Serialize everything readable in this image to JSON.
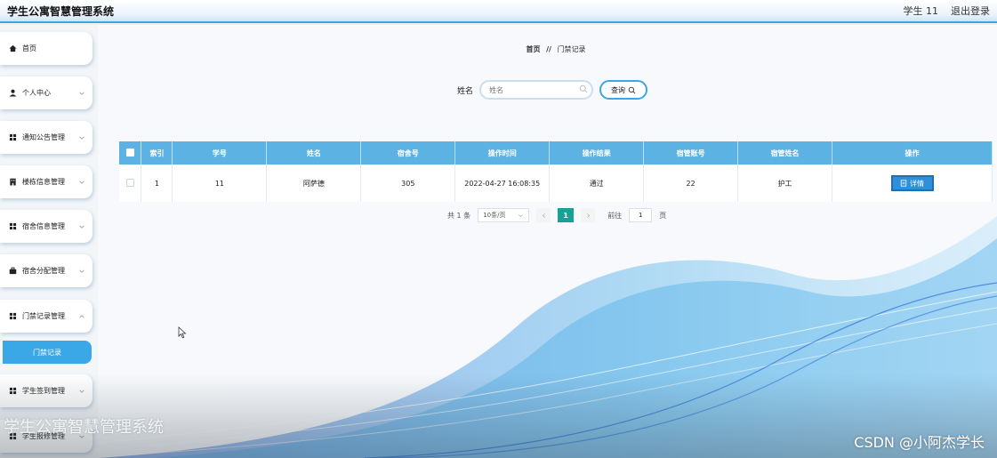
{
  "header": {
    "title": "学生公寓智慧管理系统",
    "user": "学生 11",
    "logout": "退出登录"
  },
  "sidebar": {
    "items": [
      {
        "label": "首页",
        "icon": "home-icon",
        "has_chevron": false
      },
      {
        "label": "个人中心",
        "icon": "user-icon",
        "has_chevron": true
      },
      {
        "label": "通知公告管理",
        "icon": "grid-icon",
        "has_chevron": true
      },
      {
        "label": "楼栋信息管理",
        "icon": "building-icon",
        "has_chevron": true
      },
      {
        "label": "宿舍信息管理",
        "icon": "grid-icon",
        "has_chevron": true
      },
      {
        "label": "宿舍分配管理",
        "icon": "briefcase-icon",
        "has_chevron": true
      },
      {
        "label": "门禁记录管理",
        "icon": "grid-icon",
        "has_chevron": true
      },
      {
        "label": "学生签到管理",
        "icon": "grid-icon",
        "has_chevron": true
      },
      {
        "label": "学生报修管理",
        "icon": "grid-icon",
        "has_chevron": true
      }
    ],
    "active_sub": "门禁记录"
  },
  "breadcrumb": {
    "home": "首页",
    "separator": "//",
    "current": "门禁记录"
  },
  "search": {
    "label": "姓名",
    "placeholder": "姓名",
    "button": "查询"
  },
  "table": {
    "columns": [
      "索引",
      "学号",
      "姓名",
      "宿舍号",
      "操作时间",
      "操作结果",
      "宿管账号",
      "宿管姓名",
      "操作"
    ],
    "rows": [
      {
        "index": "1",
        "student_no": "11",
        "name": "阿萨德",
        "room": "305",
        "time": "2022-04-27 16:08:35",
        "result": "通过",
        "admin_account": "22",
        "admin_name": "护工",
        "action": "详情"
      }
    ]
  },
  "pagination": {
    "total": "共 1 条",
    "page_size": "10条/页",
    "current": "1",
    "goto_label": "前往",
    "goto_value": "1",
    "page_suffix": "页"
  },
  "watermarks": {
    "left": "学生公寓智慧管理系统",
    "right": "CSDN @小阿杰学长"
  },
  "colors": {
    "accent": "#3aa7e6",
    "table_header": "#5bb2e3",
    "pager_active": "#14a394",
    "detail_button": "#2f8fd8"
  }
}
